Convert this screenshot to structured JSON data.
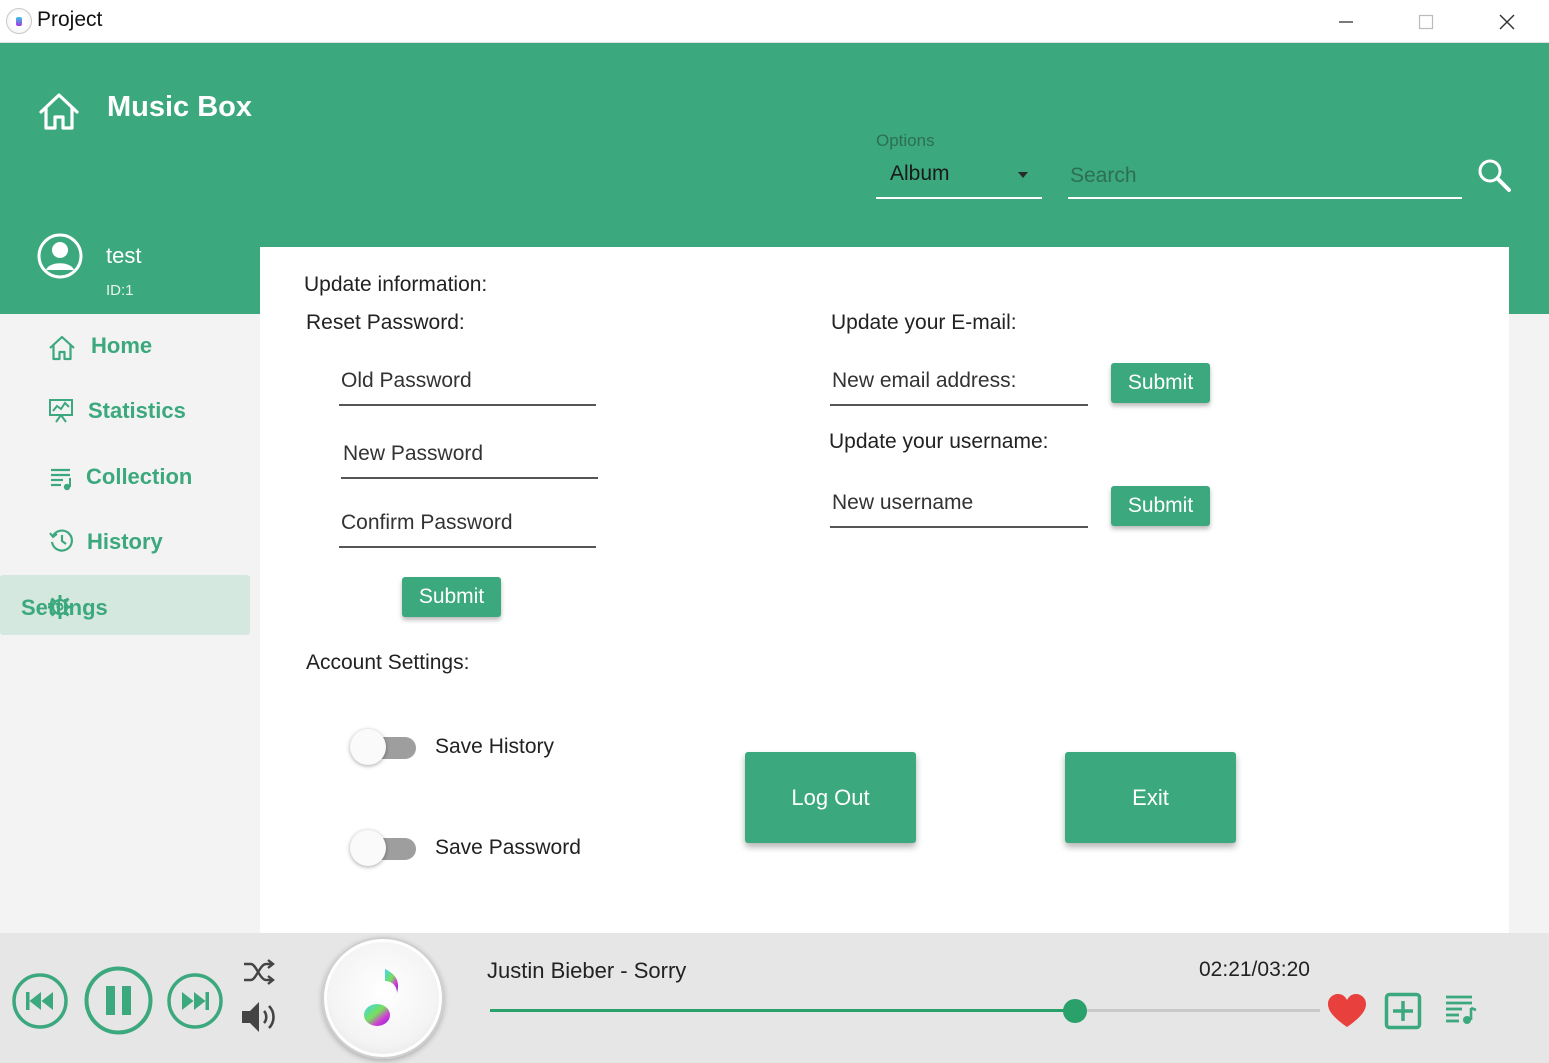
{
  "window": {
    "title": "Project",
    "controls": {
      "minimize": "minimize-icon",
      "maximize": "maximize-icon",
      "close": "close-icon"
    }
  },
  "header": {
    "title": "Music Box",
    "options": {
      "label": "Options",
      "selected": "Album"
    },
    "search": {
      "placeholder": "Search"
    }
  },
  "user": {
    "name": "test",
    "id_label": "ID:1"
  },
  "sidebar": {
    "items": [
      {
        "label": "Home",
        "icon": "home-icon"
      },
      {
        "label": "Statistics",
        "icon": "statistics-icon"
      },
      {
        "label": "Collection",
        "icon": "collection-icon"
      },
      {
        "label": "History",
        "icon": "history-icon"
      },
      {
        "label": "Settings",
        "icon": "gear-icon",
        "active": true
      }
    ]
  },
  "settings": {
    "heading": "Update information:",
    "reset_password": {
      "heading": "Reset Password:",
      "old_placeholder": "Old Password",
      "new_placeholder": "New Password",
      "confirm_placeholder": "Confirm Password",
      "submit": "Submit"
    },
    "email": {
      "heading": "Update your E-mail:",
      "placeholder": "New email address:",
      "submit": "Submit"
    },
    "username": {
      "heading": "Update your username:",
      "placeholder": "New username",
      "submit": "Submit"
    },
    "account": {
      "heading": "Account Settings:",
      "save_history": {
        "label": "Save History",
        "on": false
      },
      "save_password": {
        "label": "Save Password",
        "on": false
      }
    },
    "logout": "Log Out",
    "exit": "Exit"
  },
  "player": {
    "track": "Justin Bieber - Sorry",
    "time": "02:21/03:20",
    "progress_fraction": 0.705,
    "liked": true
  },
  "colors": {
    "primary": "#3ba87e",
    "active_nav_bg": "#d5e8e0",
    "like": "#e8403c"
  }
}
